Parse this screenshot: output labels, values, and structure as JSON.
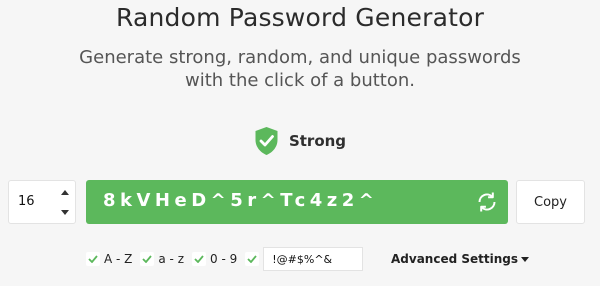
{
  "header": {
    "title": "Random Password Generator",
    "subtitle": "Generate strong, random, and unique passwords with the click of a button."
  },
  "strength": {
    "label": "Strong",
    "color": "#5cb85c",
    "icon": "shield-check-icon"
  },
  "length": {
    "value": "16"
  },
  "password": {
    "value": "8kVHeD^5r^Tc4z2^",
    "background": "#5cb85c",
    "refresh_icon": "refresh-icon"
  },
  "copy": {
    "label": "Copy"
  },
  "options": [
    {
      "label": "A - Z",
      "checked": true
    },
    {
      "label": "a - z",
      "checked": true
    },
    {
      "label": "0 - 9",
      "checked": true
    },
    {
      "label": "",
      "checked": true
    }
  ],
  "symbols": {
    "value": "!@#$%^&"
  },
  "advanced": {
    "label": "Advanced Settings",
    "icon": "caret-down-icon"
  }
}
